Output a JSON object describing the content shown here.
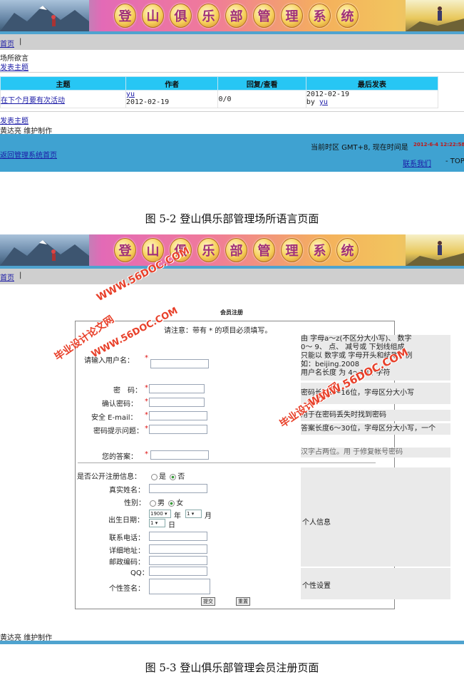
{
  "top": {
    "banner_title": [
      "登",
      "山",
      "俱",
      "乐",
      "部",
      "管",
      "理",
      "系",
      "统"
    ],
    "nav_home": "首页",
    "nav_sep": "|",
    "section_title": "场所欲言",
    "post_link": "发表主题",
    "table": {
      "headers": [
        "主题",
        "作者",
        "回复/查看",
        "最后发表"
      ],
      "rows": [
        {
          "topic": "在下个月要有次活动",
          "author": "yu",
          "author_date": "2012-02-19",
          "replies": "0/0",
          "last_date": "2012-02-19",
          "last_by": "by",
          "last_user": "yu"
        }
      ]
    },
    "post_link_bottom": "发表主题",
    "maintainer": "黄达亮 维护制作",
    "footer": {
      "back_link": "返回管理系统首页",
      "timezone": "当前时区 GMT+8, 现在时间是",
      "time": "2012-6-4 12:22:58 AM",
      "contact": "联系我们",
      "top": "- TOP"
    },
    "caption": "图 5-2 登山俱乐部管理场所语言页面"
  },
  "bottom": {
    "nav_home": "首页",
    "nav_sep": "|",
    "form_title": "会员注册",
    "notice": "请注意：带有 * 的项目必须填写。",
    "fields": {
      "username": "请输入用户名：",
      "password": "密　码：",
      "confirm": "确认密码：",
      "email": "安全 E-mail：",
      "question": "密码提示问题：",
      "answer": "您的答案：",
      "public": "是否公开注册信息：",
      "public_yes": "是",
      "public_no": "否",
      "realname": "真实姓名：",
      "gender": "性别：",
      "male": "男",
      "female": "女",
      "birthday": "出生日期：",
      "year_value": "1900",
      "year_unit": "年",
      "month_value": "1",
      "month_unit": "月",
      "day_value": "1",
      "day_unit": "日",
      "phone": "联系电话：",
      "address": "详细地址：",
      "zip": "邮政编码：",
      "qq": "QQ：",
      "signature": "个性签名："
    },
    "hints": {
      "username": [
        "由 字母a～z(不区分大小写)、 数字",
        "0～ 9、 点、 减号或 下划线组成",
        "只能以 数字或 字母开头和结尾，例",
        "如：beijing.2008",
        "用户名长度 为 4～18个字符"
      ],
      "password": "密码长度6～16位，字母区分大小写",
      "email": "用于在密码丢失时找到密码",
      "answer1": "答案长度6～30位，字母区分大小写，一个",
      "answer2": "汉字占两位。用 于修复帐号密码",
      "personal": "个人信息",
      "personal_setting": "个性设置"
    },
    "submit": "提交",
    "reset": "重置",
    "maintainer": "黄达亮 维护制作",
    "caption": "图 5-3 登山俱乐部管理会员注册页面"
  },
  "watermarks": [
    "WWW.56DOC.COM",
    "毕业设计论文网",
    "WWW.56DOC.COM",
    "毕业设计论文网",
    "WWW.56DOC.COM"
  ],
  "colors": {
    "blue_bar": "#4fa3cf",
    "table_header": "#27c6f4",
    "gray_bar": "#cfcfcf",
    "watermark": "#e8402a"
  }
}
